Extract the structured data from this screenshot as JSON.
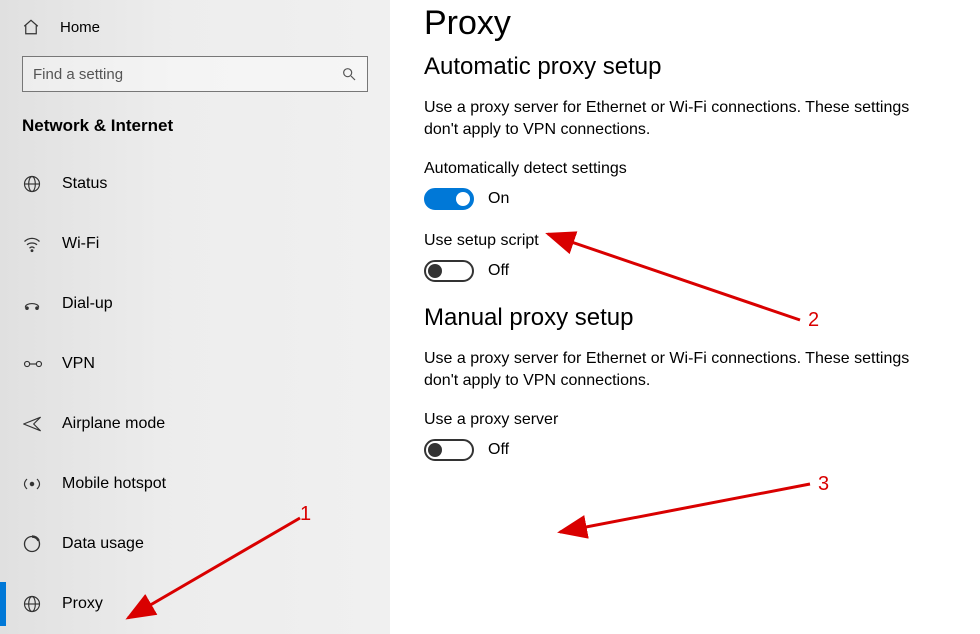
{
  "sidebar": {
    "home": "Home",
    "search_placeholder": "Find a setting",
    "section": "Network & Internet",
    "items": [
      {
        "id": "status",
        "label": "Status"
      },
      {
        "id": "wifi",
        "label": "Wi-Fi"
      },
      {
        "id": "dialup",
        "label": "Dial-up"
      },
      {
        "id": "vpn",
        "label": "VPN"
      },
      {
        "id": "airplane",
        "label": "Airplane mode"
      },
      {
        "id": "hotspot",
        "label": "Mobile hotspot"
      },
      {
        "id": "datausage",
        "label": "Data usage"
      },
      {
        "id": "proxy",
        "label": "Proxy"
      }
    ]
  },
  "main": {
    "title": "Proxy",
    "auto": {
      "heading": "Automatic proxy setup",
      "desc": "Use a proxy server for Ethernet or Wi-Fi connections. These settings don't apply to VPN connections.",
      "detect_label": "Automatically detect settings",
      "detect_state": "On",
      "script_label": "Use setup script",
      "script_state": "Off"
    },
    "manual": {
      "heading": "Manual proxy setup",
      "desc": "Use a proxy server for Ethernet or Wi-Fi connections. These settings don't apply to VPN connections.",
      "use_label": "Use a proxy server",
      "use_state": "Off"
    }
  },
  "annotations": {
    "n1": "1",
    "n2": "2",
    "n3": "3"
  }
}
